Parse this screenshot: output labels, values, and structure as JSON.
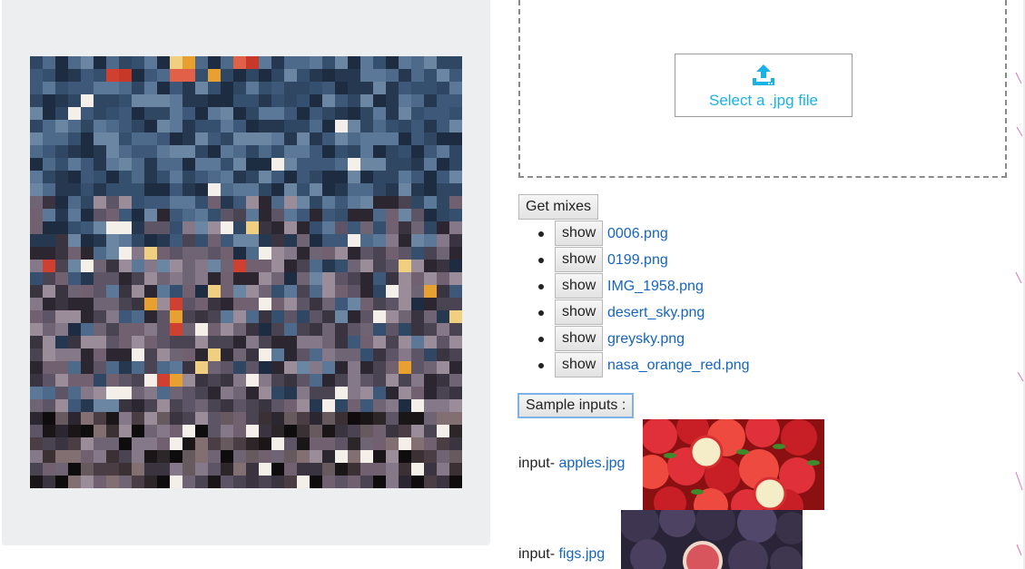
{
  "upload": {
    "label": "Select a .jpg file",
    "icon": "upload-icon"
  },
  "mixes": {
    "button_label": "Get mixes",
    "show_label": "show",
    "items": [
      "0006.png",
      "0199.png",
      "IMG_1958.png",
      "desert_sky.png",
      "greysky.png",
      "nasa_orange_red.png"
    ]
  },
  "samples": {
    "button_label": "Sample inputs :",
    "items": [
      {
        "prefix": "input- ",
        "name": "apples.jpg"
      },
      {
        "prefix": "input- ",
        "name": "figs.jpg"
      }
    ]
  },
  "colors": {
    "link": "#1565c0",
    "accent": "#19b2e6",
    "panel": "#eceef0"
  }
}
